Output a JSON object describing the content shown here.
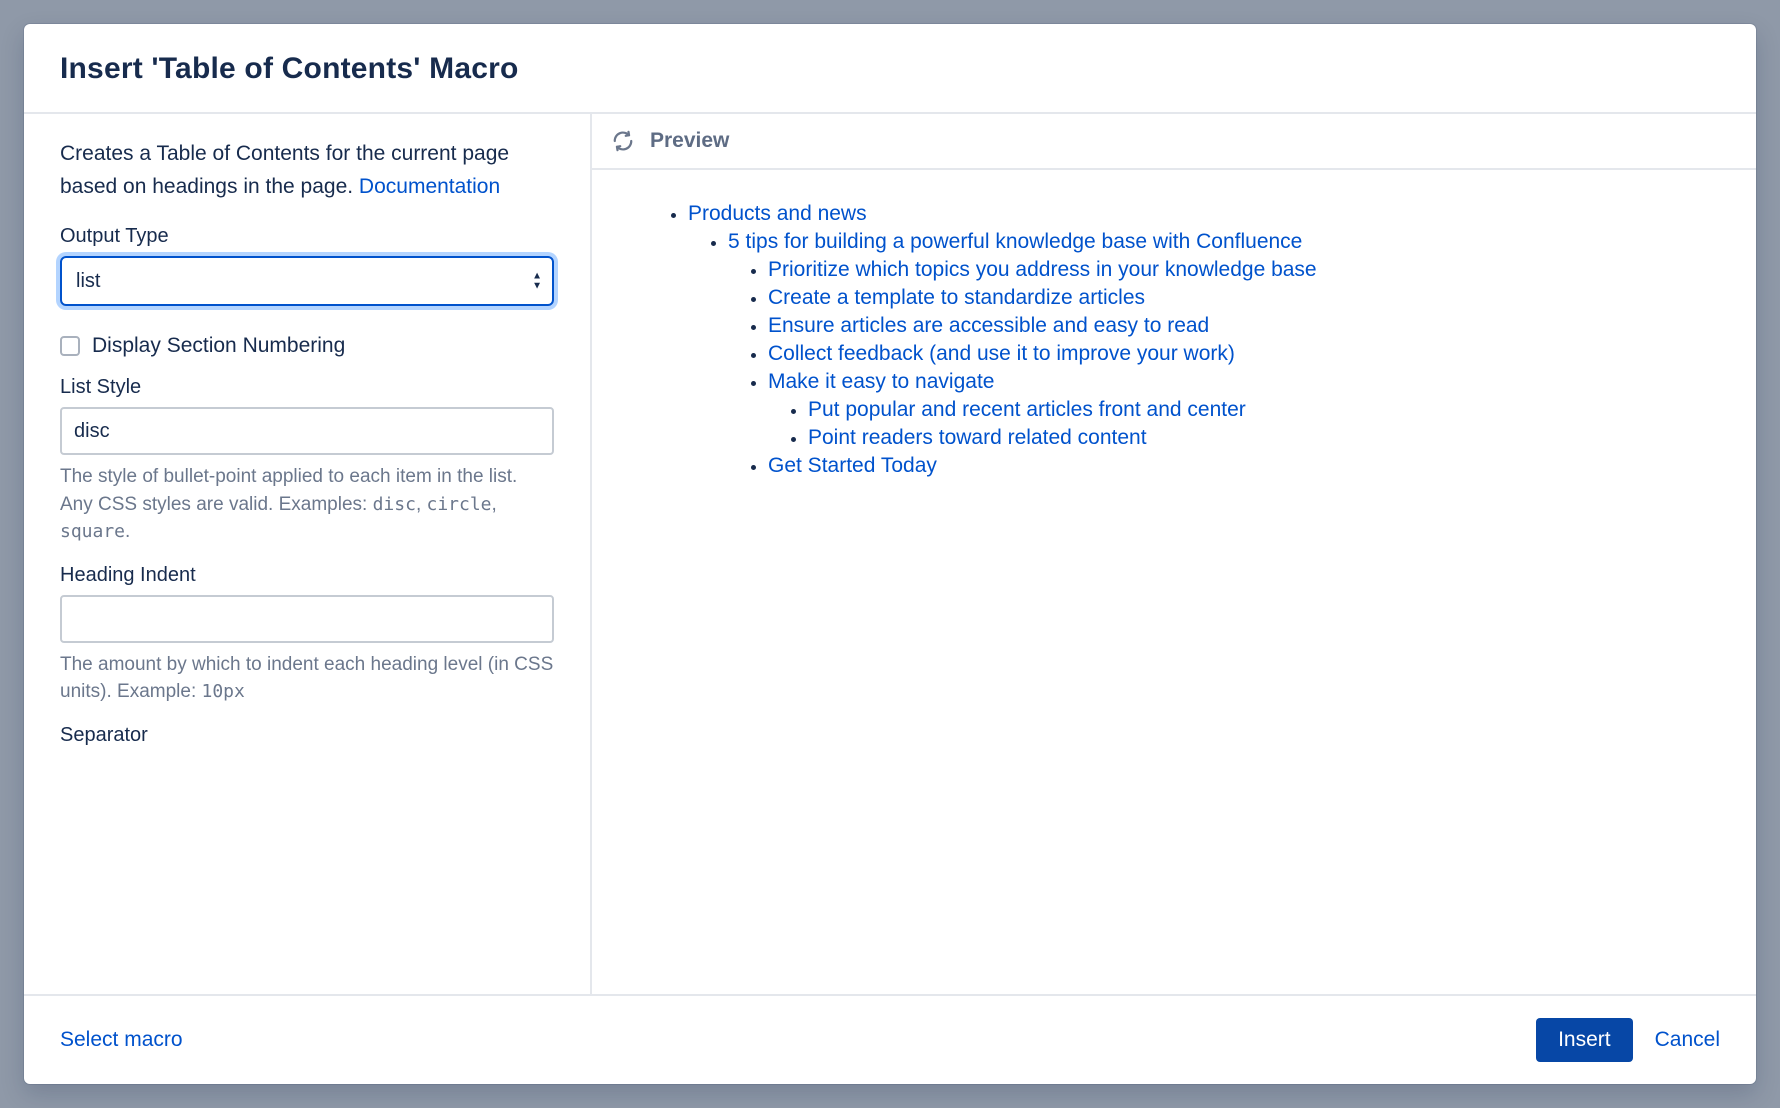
{
  "header": {
    "title": "Insert 'Table of Contents' Macro"
  },
  "left": {
    "description": "Creates a Table of Contents for the current page based on headings in the page. ",
    "doc_link_label": "Documentation",
    "output_type": {
      "label": "Output Type",
      "value": "list"
    },
    "section_numbering": {
      "label": "Display Section Numbering",
      "checked": false
    },
    "list_style": {
      "label": "List Style",
      "value": "disc",
      "help_prefix": "The style of bullet-point applied to each item in the list. Any CSS styles are valid. Examples: ",
      "help_code1": "disc",
      "help_sep1": ", ",
      "help_code2": "circle",
      "help_sep2": ", ",
      "help_code3": "square",
      "help_suffix": "."
    },
    "heading_indent": {
      "label": "Heading Indent",
      "value": "",
      "help_prefix": "The amount by which to indent each heading level (in CSS units). Example: ",
      "help_code": "10px"
    },
    "separator": {
      "label": "Separator"
    }
  },
  "preview": {
    "title": "Preview",
    "toc": [
      {
        "label": "Products and news",
        "children": [
          {
            "label": "5 tips for building a powerful knowledge base with Confluence",
            "children": [
              {
                "label": "Prioritize which topics you address in your knowledge base"
              },
              {
                "label": "Create a template to standardize articles"
              },
              {
                "label": "Ensure articles are accessible and easy to read"
              },
              {
                "label": "Collect feedback (and use it to improve your work)"
              },
              {
                "label": "Make it easy to navigate",
                "children": [
                  {
                    "label": "Put popular and recent articles front and center"
                  },
                  {
                    "label": "Point readers toward related content"
                  }
                ]
              },
              {
                "label": "Get Started Today"
              }
            ]
          }
        ]
      }
    ]
  },
  "footer": {
    "select_macro": "Select macro",
    "insert": "Insert",
    "cancel": "Cancel"
  }
}
